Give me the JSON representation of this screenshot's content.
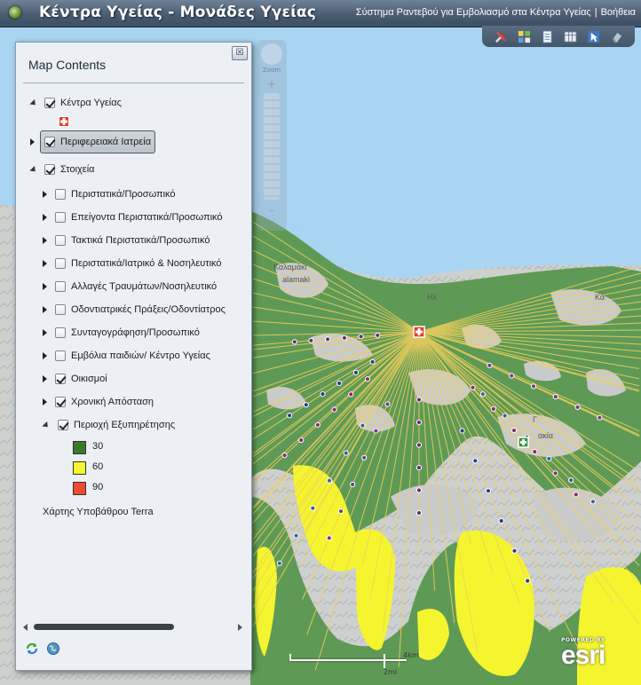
{
  "header": {
    "title": "Κέντρα Υγείας - Μονάδες Υγείας",
    "link_system": "Σύστημα Ραντεβού για Εμβολιασμό στα Κέντρα Υγείας",
    "separator": "|",
    "link_help": "Βοήθεια"
  },
  "toolbar": {
    "icons": [
      "tools-icon",
      "basemap-grid-icon",
      "document-icon",
      "table-icon",
      "cursor-icon",
      "eraser-icon"
    ]
  },
  "panel": {
    "title": "Map Contents",
    "close_label": "☒",
    "layers": [
      {
        "label": "Κέντρα Υγείας",
        "checked": true,
        "expanded": true
      },
      {
        "label": "Περιφερειακά Ιατρεία",
        "checked": true,
        "expanded": false,
        "selected": true
      },
      {
        "label": "Στοιχεία",
        "checked": true,
        "expanded": true
      },
      {
        "label": "Περιστατικά/Προσωπικό",
        "checked": false
      },
      {
        "label": "Επείγοντα Περιστατικά/Προσωπικό",
        "checked": false
      },
      {
        "label": "Τακτικά Περιστατικά/Προσωπικό",
        "checked": false
      },
      {
        "label": "Περιστατικά/Ιατρικό & Νοσηλευτικό",
        "checked": false
      },
      {
        "label": "Αλλαγές Τραυμάτων/Νοσηλευτικό",
        "checked": false
      },
      {
        "label": "Οδοντιατρικές Πράξεις/Οδοντίατρος",
        "checked": false
      },
      {
        "label": "Συνταγογράφηση/Προσωπικό",
        "checked": false
      },
      {
        "label": "Εμβόλια παιδιών/ Κέντρο Υγείας",
        "checked": false
      },
      {
        "label": "Οικισμοί",
        "checked": true
      },
      {
        "label": "Χρονική Απόσταση",
        "checked": true
      },
      {
        "label": "Περιοχή Εξυπηρέτησης",
        "checked": true,
        "expanded": true
      }
    ],
    "legend": [
      {
        "label": "30",
        "color": "#3a7a2c"
      },
      {
        "label": "60",
        "color": "#f5f52e"
      },
      {
        "label": "90",
        "color": "#f04a32"
      }
    ],
    "basemap_label": "Χάρτης Υποβάθρου Terra"
  },
  "map": {
    "labels": {
      "town1": "Καλαμάκι",
      "town1b": "alamaki",
      "town2": "Ηλ",
      "town3": "Κα",
      "town4": "Γ",
      "town5": "ακία"
    },
    "nav_zoom_label": "Zoom",
    "nav_plus": "+",
    "nav_minus": "-",
    "scale_km": "4km",
    "scale_mi": "2mi"
  },
  "esri": {
    "powered": "POWERED BY",
    "text": "esri"
  },
  "colors": {
    "sea": "#a8d4f0",
    "green_area": "#5f9a55",
    "grey_land": "#c8cacb",
    "yellow_area": "#f5f52e",
    "route_lines": "#f2d060",
    "health_center": "#e23a2a",
    "regional_clinic": "#2f8f3a"
  }
}
